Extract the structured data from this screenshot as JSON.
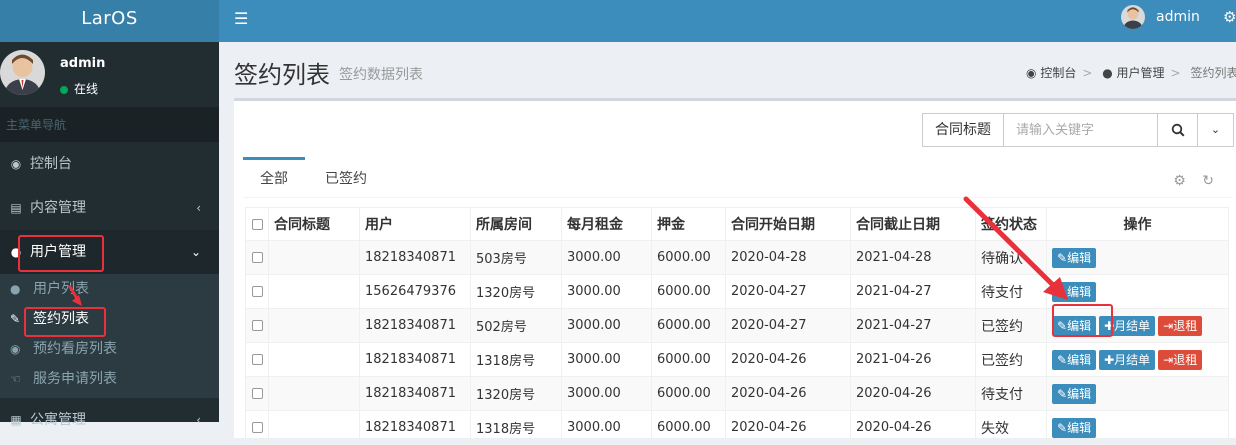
{
  "app": {
    "logo": "LarOS"
  },
  "user": {
    "name": "admin",
    "status": "在线"
  },
  "sidebar": {
    "header": "主菜单导航",
    "items": [
      {
        "label": "控制台",
        "icon": "dashboard-icon"
      },
      {
        "label": "内容管理",
        "icon": "book-icon"
      },
      {
        "label": "用户管理",
        "icon": "users-icon"
      }
    ],
    "sub_items": [
      {
        "label": "用户列表",
        "icon": "user-icon"
      },
      {
        "label": "签约列表",
        "icon": "edit-icon"
      },
      {
        "label": "预约看房列表",
        "icon": "eye-icon"
      },
      {
        "label": "服务申请列表",
        "icon": "hand-icon"
      }
    ],
    "last_item": {
      "label": "公寓管理",
      "icon": "building-icon"
    }
  },
  "header": {
    "user_name": "admin"
  },
  "page": {
    "title": "签约列表",
    "subtitle": "签约数据列表"
  },
  "breadcrumb": [
    "控制台",
    "用户管理",
    "签约列表"
  ],
  "search": {
    "field_label": "合同标题",
    "placeholder": "请输入关键字"
  },
  "tabs": [
    "全部",
    "已签约"
  ],
  "table": {
    "headers": [
      "合同标题",
      "用户",
      "所属房间",
      "每月租金",
      "押金",
      "合同开始日期",
      "合同截止日期",
      "签约状态",
      "操作"
    ],
    "rows": [
      {
        "title": "",
        "user": "18218340871",
        "room": "503房号",
        "rent": "3000.00",
        "deposit": "6000.00",
        "start": "2020-04-28",
        "end": "2021-04-28",
        "status": "待确认"
      },
      {
        "title": "",
        "user": "15626479376",
        "room": "1320房号",
        "rent": "3000.00",
        "deposit": "6000.00",
        "start": "2020-04-27",
        "end": "2021-04-27",
        "status": "待支付"
      },
      {
        "title": "",
        "user": "18218340871",
        "room": "502房号",
        "rent": "3000.00",
        "deposit": "6000.00",
        "start": "2020-04-27",
        "end": "2021-04-27",
        "status": "已签约"
      },
      {
        "title": "",
        "user": "18218340871",
        "room": "1318房号",
        "rent": "3000.00",
        "deposit": "6000.00",
        "start": "2020-04-26",
        "end": "2021-04-26",
        "status": "已签约"
      },
      {
        "title": "",
        "user": "18218340871",
        "room": "1320房号",
        "rent": "3000.00",
        "deposit": "6000.00",
        "start": "2020-04-26",
        "end": "2020-04-26",
        "status": "待支付"
      },
      {
        "title": "",
        "user": "18218340871",
        "room": "1318房号",
        "rent": "3000.00",
        "deposit": "6000.00",
        "start": "2020-04-26",
        "end": "2020-04-26",
        "status": "失效"
      }
    ],
    "actions": {
      "edit": "编辑",
      "monthly": "月结单",
      "checkout": "退租"
    }
  },
  "colors": {
    "primary": "#3c8dbc",
    "sidebar": "#222d32",
    "danger": "#dd4b39",
    "highlight": "#e8313a"
  }
}
